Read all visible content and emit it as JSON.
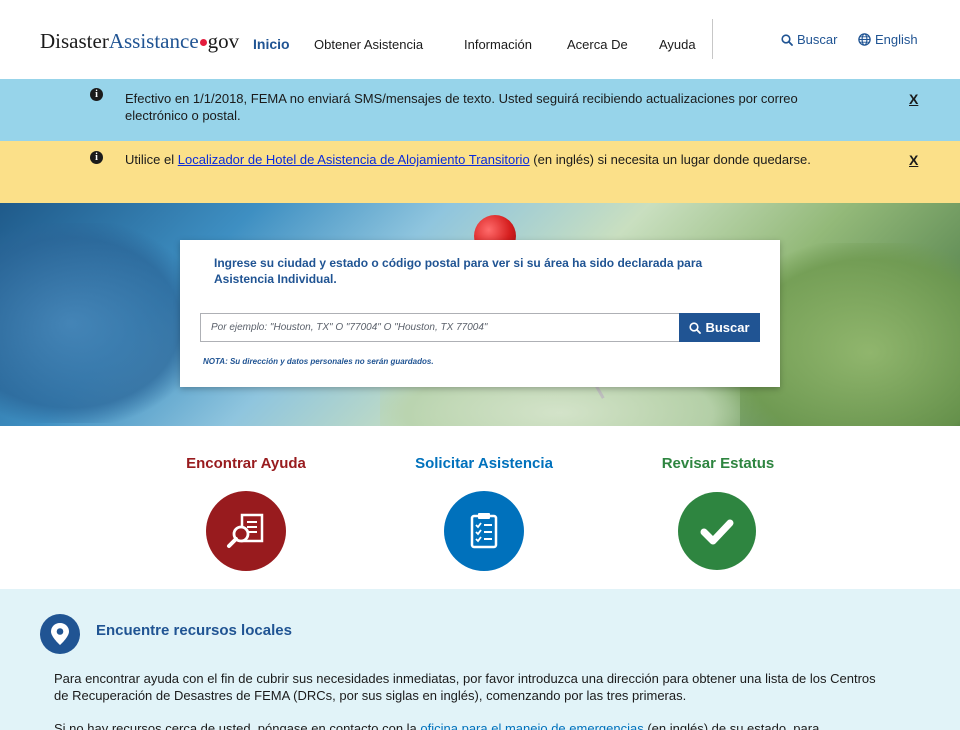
{
  "header": {
    "logo": {
      "part1": "Disaster",
      "part2": "Assistance",
      "part3": "gov"
    },
    "nav": [
      {
        "label": "Inicio",
        "active": true
      },
      {
        "label": "Obtener Asistencia"
      },
      {
        "label": "Información"
      },
      {
        "label": "Acerca De"
      },
      {
        "label": "Ayuda"
      }
    ],
    "search_link": "Buscar",
    "language_link": "English"
  },
  "alerts": [
    {
      "text": "Efectivo en 1/1/2018, FEMA no enviará SMS/mensajes de texto. Usted seguirá recibiendo actualizaciones por correo electrónico o postal.",
      "close": "X"
    },
    {
      "text_before": "Utilice el ",
      "link": "Localizador de Hotel de Asistencia de Alojamiento Transitorio",
      "text_after": " (en inglés) si necesita un lugar donde quedarse.",
      "close": "X"
    }
  ],
  "search": {
    "heading": "Ingrese su ciudad y estado o código postal para ver si su área ha sido declarada para Asistencia Individual.",
    "placeholder": "Por ejemplo: \"Houston, TX\" O \"77004\" O \"Houston, TX 77004\"",
    "button_label": "Buscar",
    "note": "NOTA: Su dirección y datos personales no serán guardados."
  },
  "actions": [
    {
      "title": "Encontrar Ayuda",
      "color": "#981b1e",
      "icon": "magnifier-document-icon"
    },
    {
      "title": "Solicitar Asistencia",
      "color": "#0071bc",
      "icon": "clipboard-checklist-icon"
    },
    {
      "title": "Revisar Estatus",
      "color": "#2e8540",
      "icon": "checkmark-icon"
    }
  ],
  "resources": {
    "title": "Encuentre recursos locales",
    "paragraph1": "Para encontrar ayuda con el fin de cubrir sus necesidades inmediatas, por favor introduzca una dirección para obtener una lista de los Centros de Recuperación de Desastres de FEMA (DRCs, por sus siglas en inglés), comenzando por las tres primeras.",
    "paragraph2_before": "Si no hay recursos cerca de usted, póngase en contacto con la ",
    "paragraph2_link": "oficina para el manejo de emergencias",
    "paragraph2_after": " (en inglés) de su estado, para"
  },
  "colors": {
    "primary": "#205493",
    "alert_blue": "#97d4ea",
    "alert_yellow": "#fbe089",
    "resources_bg": "#e1f3f8"
  }
}
